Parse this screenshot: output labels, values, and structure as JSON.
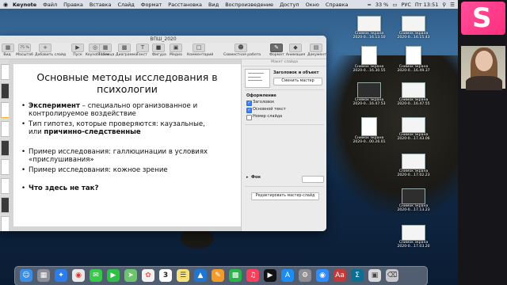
{
  "menubar": {
    "apple": "",
    "items": [
      "Keynote",
      "Файл",
      "Правка",
      "Вставка",
      "Слайд",
      "Формат",
      "Расстановка",
      "Вид",
      "Воспроизведение",
      "Доступ",
      "Окно",
      "Справка"
    ],
    "battery": "33 %",
    "flag": "РУС",
    "clock": "Пт 13:51"
  },
  "window": {
    "title": "ВПШ_2020",
    "toolbar": [
      "Вид",
      "Масштаб",
      "Добавить слайд",
      "Пуск",
      "Keynote Live",
      "Таблица",
      "Диаграмма",
      "Текст",
      "Фигура",
      "Медиа",
      "Комментарий",
      "Совместная работа",
      "Формат",
      "Анимация",
      "Документ"
    ],
    "zoom_value": "75 %"
  },
  "slide": {
    "title_line1": "Основные методы исследования в",
    "title_line2": "психологии",
    "b1_bold": "Эксперимент",
    "b1_rest": " – специально организованное и",
    "b1_line2": "контролируемое воздействие",
    "b2_pre": "Тип гипотез, которые проверяются: каузальные,",
    "b2_l2_pre": "или ",
    "b2_l2_bold": "причинно-следственные",
    "b3_line1": "Пример исследования: галлюцинации в условиях",
    "b3_line2": "«прислушивания»",
    "b4": "Пример исследования: кожное зрение",
    "b5": "Что здесь не так?",
    "bullet": "•"
  },
  "inspector": {
    "header": "Макет слайда",
    "layout_name": "Заголовок и объект",
    "change_master": "Сменить мастер",
    "appearance": "Оформление",
    "cb_title": "Заголовок",
    "cb_body": "Основной текст",
    "cb_number": "Номер слайда",
    "background": "Фон",
    "edit_master": "Редактировать мастер-слайд"
  },
  "desktop_icons": [
    {
      "caption1": "Снимок экрана",
      "caption2": "2020-0...16.13.50"
    },
    {
      "caption1": "Снимок экрана",
      "caption2": "2020-0...16.15.43"
    },
    {
      "caption1": "Снимок экрана",
      "caption2": "2020-0...16.30.55"
    },
    {
      "caption1": "Снимок экрана",
      "caption2": "2020-0...16.49.37"
    },
    {
      "caption1": "Снимок экрана",
      "caption2": "2020-0...16.47.53"
    },
    {
      "caption1": "Снимок экрана",
      "caption2": "2020-0...16.47.55"
    },
    {
      "caption1": "Снимок экрана",
      "caption2": "2020-0...00.26.01"
    },
    {
      "caption1": "Снимок экрана",
      "caption2": "2020-0...17.43.06"
    },
    {
      "caption1": "Снимок экрана",
      "caption2": "2020-0...17.02.23"
    },
    {
      "caption1": "Снимок экрана",
      "caption2": "2020-0...17.13.23"
    },
    {
      "caption1": "Снимок экрана",
      "caption2": "2020-0...17.03.20"
    }
  ],
  "dock_apps": [
    "finder-icon",
    "launchpad-icon",
    "safari-icon",
    "chrome-icon",
    "messages-icon",
    "facetime-icon",
    "maps-icon",
    "photos-icon",
    "calendar-icon",
    "notes-icon",
    "keynote-icon",
    "pages-icon",
    "numbers-icon",
    "music-icon",
    "tv-icon",
    "appstore-icon",
    "settings-icon",
    "zoom-icon",
    "dictionary-icon",
    "math-icon",
    "preview-icon",
    "trash-icon"
  ],
  "calendar_day": "3",
  "logo_letter": "S"
}
